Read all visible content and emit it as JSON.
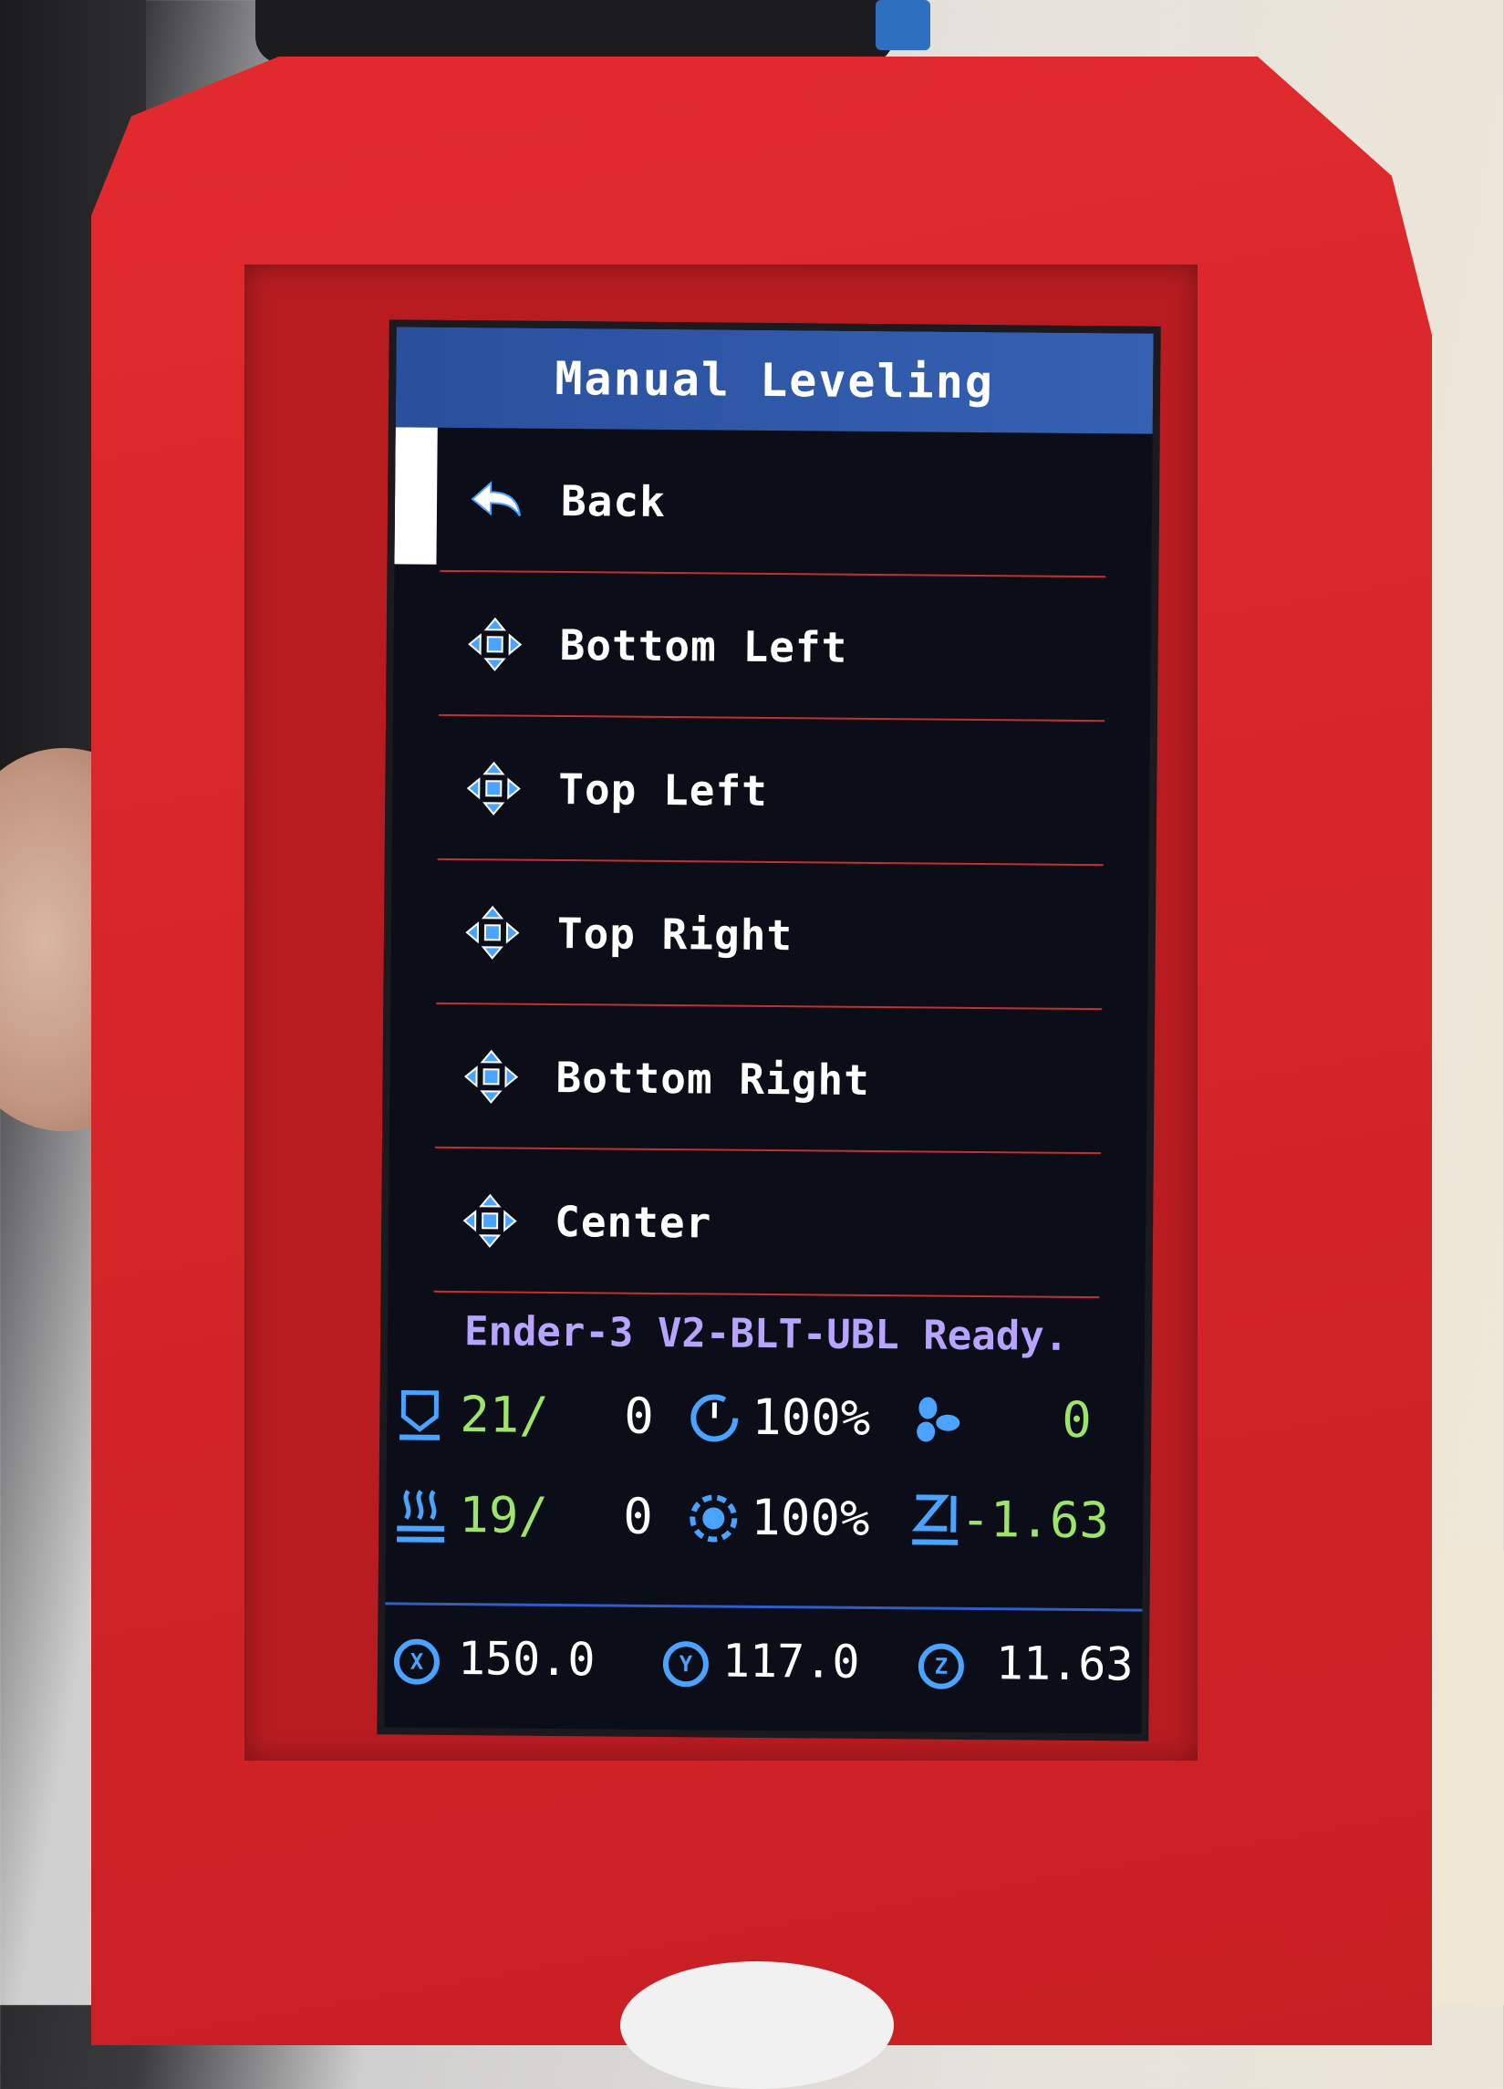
{
  "screen": {
    "title": "Manual Leveling",
    "menu": [
      {
        "label": "Back",
        "icon": "back-arrow-icon",
        "selected": true
      },
      {
        "label": "Bottom Left",
        "icon": "move-icon"
      },
      {
        "label": "Top Left",
        "icon": "move-icon"
      },
      {
        "label": "Top Right",
        "icon": "move-icon"
      },
      {
        "label": "Bottom Right",
        "icon": "move-icon"
      },
      {
        "label": "Center",
        "icon": "move-icon"
      }
    ],
    "status_message": "Ender-3 V2-BLT-UBL Ready.",
    "hotend": {
      "current": "21/",
      "target": "0",
      "icon": "hotend-icon"
    },
    "bed": {
      "current": "19/",
      "target": "0",
      "icon": "bed-heat-icon"
    },
    "feedrate": {
      "value": "100%",
      "icon": "speed-gauge-icon"
    },
    "flow": {
      "value": "100%",
      "icon": "extruder-flow-icon"
    },
    "fan": {
      "value": "0",
      "icon": "fan-icon"
    },
    "z_offset": {
      "value": "-1.63",
      "icon": "z-offset-icon"
    },
    "position": {
      "x": {
        "value": "150.0",
        "icon_letter": "X"
      },
      "y": {
        "value": "117.0",
        "icon_letter": "Y"
      },
      "z": {
        "value": "11.63",
        "icon_letter": "Z"
      }
    },
    "colors": {
      "title_bg": "#3561b3",
      "separator": "#c1322f",
      "status_text": "#b7a4ff",
      "value_green": "#9fe46a",
      "accent_blue": "#4aa3ff"
    }
  }
}
